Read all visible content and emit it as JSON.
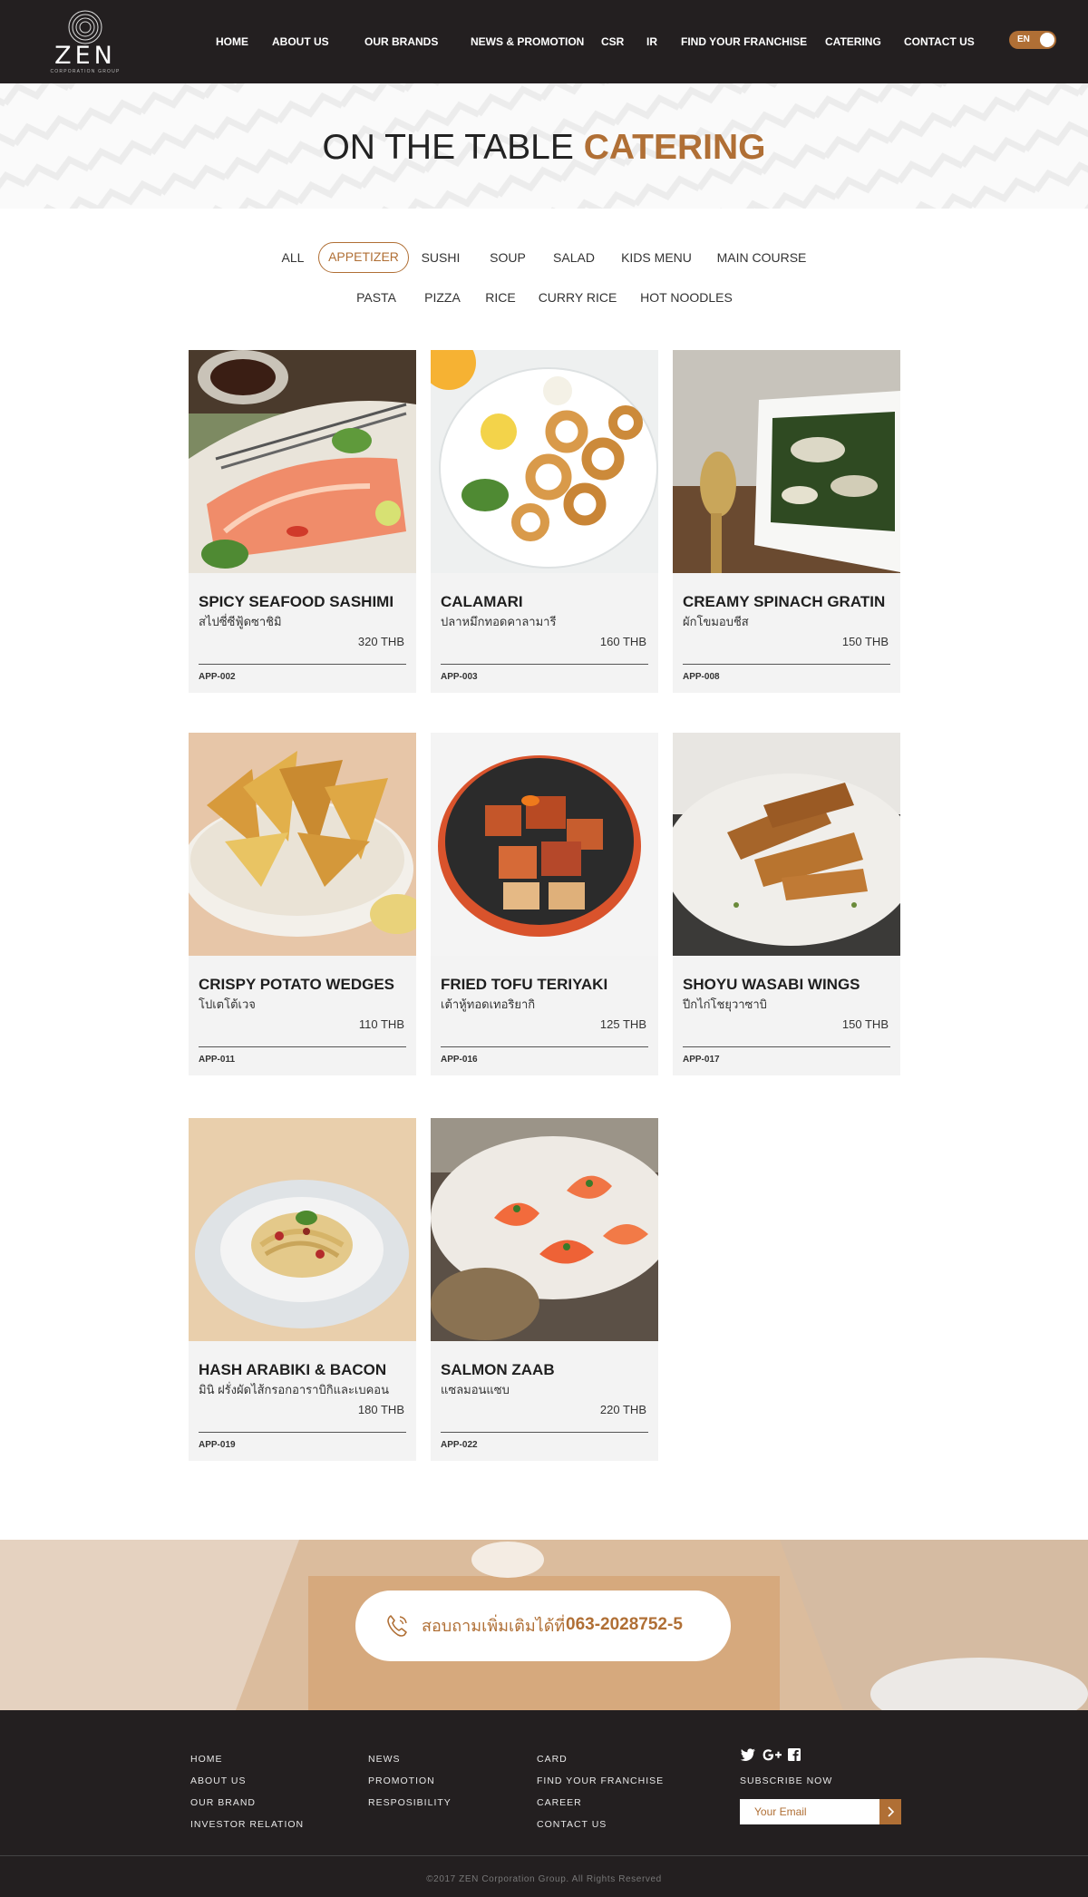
{
  "brand": {
    "logo_text": "ZEN",
    "logo_subtext": "CORPORATION GROUP"
  },
  "nav": {
    "items": [
      "HOME",
      "ABOUT US",
      "OUR BRANDS",
      "NEWS & PROMOTION",
      "CSR",
      "IR",
      "FIND YOUR FRANCHISE",
      "CATERING",
      "CONTACT US"
    ],
    "language": "EN"
  },
  "hero": {
    "title_part1": "ON THE TABLE",
    "title_part2": "CATERING"
  },
  "filters": {
    "row1": [
      "ALL",
      "APPETIZER",
      "SUSHI",
      "SOUP",
      "SALAD",
      "KIDS MENU",
      "MAIN COURSE"
    ],
    "row2": [
      "PASTA",
      "PIZZA",
      "RICE",
      "CURRY RICE",
      "HOT NOODLES"
    ],
    "active": "APPETIZER"
  },
  "menu": [
    {
      "name": "SPICY SEAFOOD SASHIMI",
      "thai": "สไปซี่ซีฟู้ดซาชิมิ",
      "price": "320 THB",
      "code": "APP-002",
      "photo": "sashimi-photo"
    },
    {
      "name": "CALAMARI",
      "thai": "ปลาหมึกทอดคาลามารี",
      "price": "160 THB",
      "code": "APP-003",
      "photo": "calamari-photo"
    },
    {
      "name": "CREAMY SPINACH GRATIN",
      "thai": "ผักโขมอบชีส",
      "price": "150 THB",
      "code": "APP-008",
      "photo": "spinach-gratin-photo"
    },
    {
      "name": "CRISPY POTATO WEDGES",
      "thai": "โปเตโต้เวจ",
      "price": "110 THB",
      "code": "APP-011",
      "photo": "potato-wedges-photo"
    },
    {
      "name": "FRIED TOFU TERIYAKI",
      "thai": "เต้าหู้ทอดเทอริยากิ",
      "price": "125 THB",
      "code": "APP-016",
      "photo": "tofu-teriyaki-photo"
    },
    {
      "name": "SHOYU WASABI WINGS",
      "thai": "ปีกไก่โชยุวาซาบิ",
      "price": "150 THB",
      "code": "APP-017",
      "photo": "chicken-wings-photo"
    },
    {
      "name": "HASH ARABIKI & BACON",
      "thai": "มินิ ฝรั่งผัดไส้กรอกอาราบิกิและเบคอน",
      "price": "180 THB",
      "code": "APP-019",
      "photo": "pasta-bacon-photo"
    },
    {
      "name": "SALMON ZAAB",
      "thai": "แซลมอนแซบ",
      "price": "220 THB",
      "code": "APP-022",
      "photo": "salmon-zaab-photo"
    }
  ],
  "contact_banner": {
    "text": "สอบถามเพิ่มเติมได้ที่",
    "phone": "063-2028752-5",
    "icon": "phone-icon"
  },
  "footer": {
    "col1": [
      "HOME",
      "ABOUT US",
      "OUR BRAND",
      "INVESTOR RELATION"
    ],
    "col2": [
      "NEWS",
      "PROMOTION",
      "RESPOSIBILITY"
    ],
    "col3": [
      "CARD",
      "FIND YOUR FRANCHISE",
      "CAREER",
      "CONTACT US"
    ],
    "social": [
      "twitter-icon",
      "google-plus-icon",
      "facebook-icon"
    ],
    "subscribe_label": "SUBSCRIBE NOW",
    "email_placeholder": "Your Email",
    "copyright": "©2017 ZEN Corporation Group. All Rights Reserved"
  },
  "colors": {
    "accent": "#b06f35",
    "header_bg": "#231f20",
    "card_bg": "#f3f3f3"
  }
}
